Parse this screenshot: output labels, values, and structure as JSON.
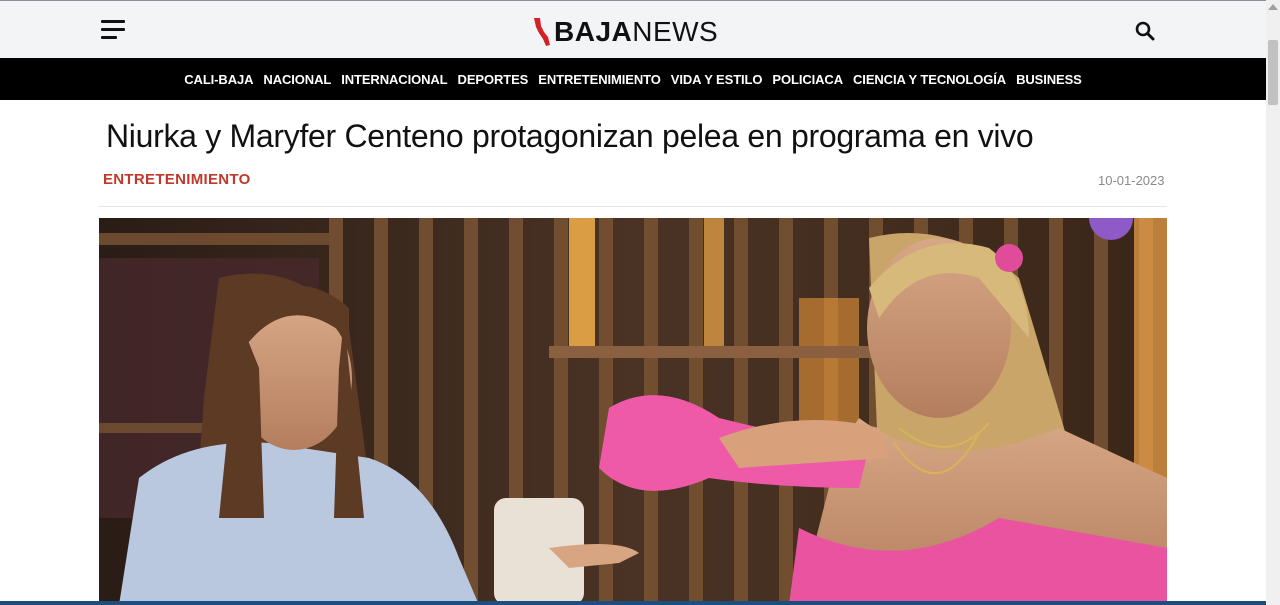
{
  "header": {
    "menu_icon": "hamburger-menu-icon",
    "logo": {
      "part1": "BAJA",
      "part2": "NEWS",
      "mark_color": "#d62027"
    },
    "search_icon": "search-icon"
  },
  "nav": {
    "items": [
      {
        "label": "CALI-BAJA"
      },
      {
        "label": "NACIONAL"
      },
      {
        "label": "INTERNACIONAL"
      },
      {
        "label": "DEPORTES"
      },
      {
        "label": "ENTRETENIMIENTO"
      },
      {
        "label": "VIDA Y ESTILO"
      },
      {
        "label": "POLICIACA"
      },
      {
        "label": "CIENCIA Y TECNOLOGÍA"
      },
      {
        "label": "BUSINESS"
      }
    ]
  },
  "article": {
    "title": "Niurka y Maryfer Centeno protagonizan pelea en programa en vivo",
    "category": "ENTRETENIMIENTO",
    "date": "10-01-2023",
    "category_color": "#c0392b"
  },
  "colors": {
    "nav_bg": "#000000",
    "topbar_bg": "#f3f4f6",
    "accent": "#d62027"
  }
}
